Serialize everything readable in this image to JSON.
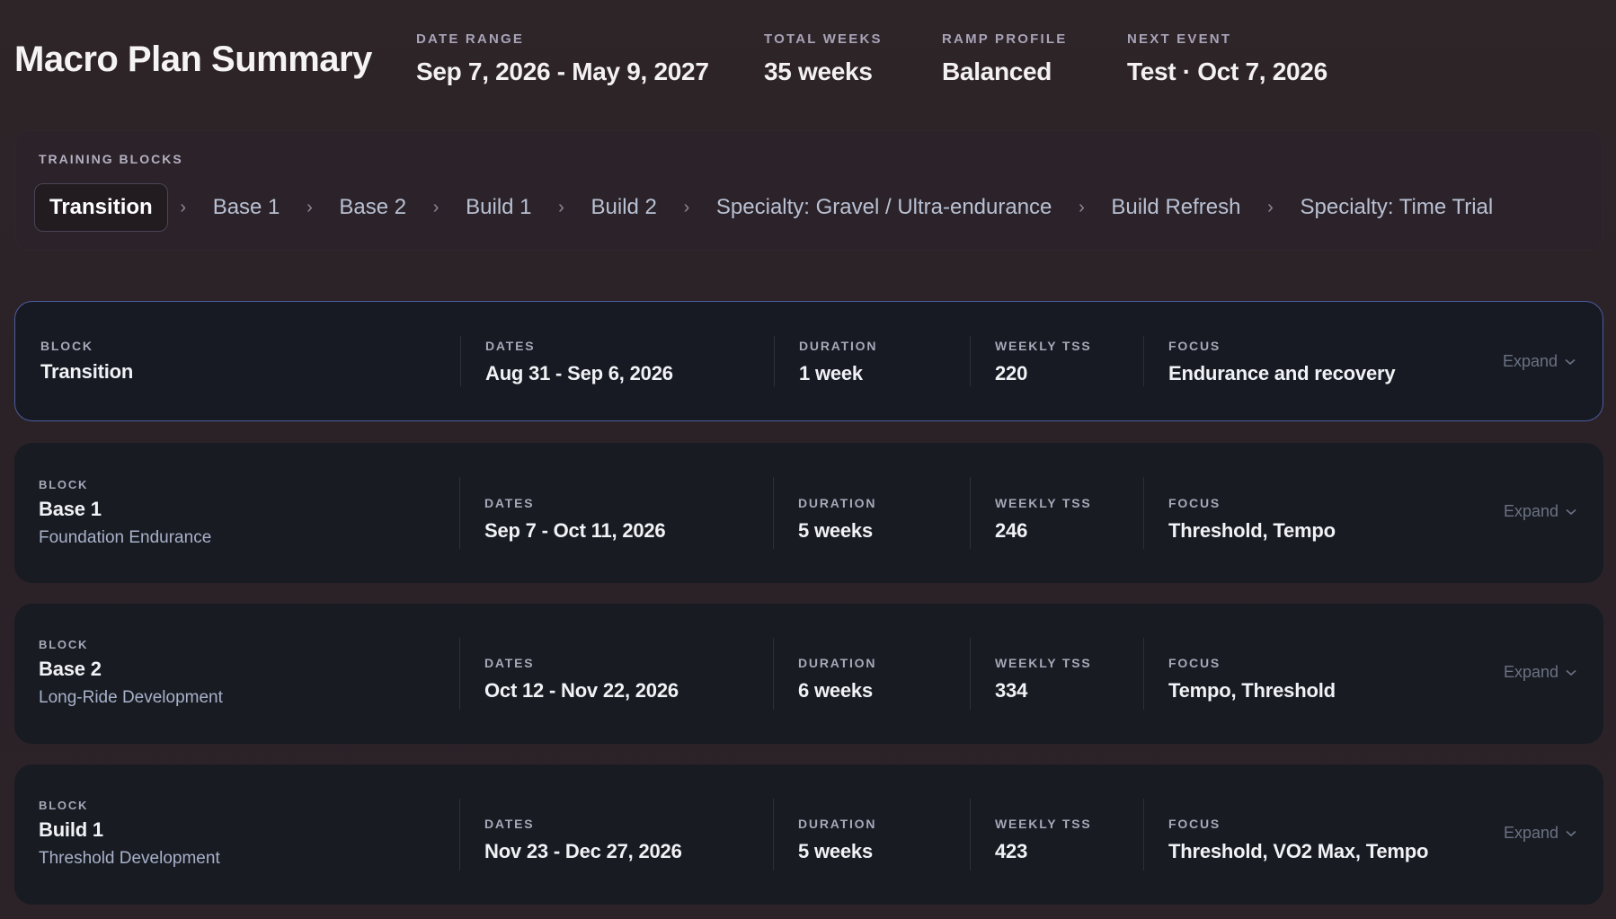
{
  "header": {
    "title": "Macro Plan Summary",
    "stats": [
      {
        "label": "DATE RANGE",
        "value": "Sep 7, 2026 - May 9, 2027"
      },
      {
        "label": "TOTAL WEEKS",
        "value": "35 weeks"
      },
      {
        "label": "RAMP PROFILE",
        "value": "Balanced"
      },
      {
        "label": "NEXT EVENT",
        "value": "Test · Oct 7, 2026"
      }
    ]
  },
  "training_blocks": {
    "title": "TRAINING BLOCKS",
    "items": [
      {
        "label": "Transition",
        "active": true
      },
      {
        "label": "Base 1",
        "active": false
      },
      {
        "label": "Base 2",
        "active": false
      },
      {
        "label": "Build 1",
        "active": false
      },
      {
        "label": "Build 2",
        "active": false
      },
      {
        "label": "Specialty: Gravel / Ultra-endurance",
        "active": false
      },
      {
        "label": "Build Refresh",
        "active": false
      },
      {
        "label": "Specialty: Time Trial",
        "active": false
      }
    ],
    "separator_icon": "chevron-right-icon"
  },
  "column_labels": {
    "block": "BLOCK",
    "dates": "DATES",
    "duration": "DURATION",
    "weekly_tss": "WEEKLY TSS",
    "focus": "FOCUS"
  },
  "expand_label": "Expand",
  "blocks": [
    {
      "name": "Transition",
      "subtitle": "",
      "dates": "Aug 31 - Sep 6, 2026",
      "duration": "1 week",
      "weekly_tss": "220",
      "focus": "Endurance and recovery",
      "selected": true
    },
    {
      "name": "Base 1",
      "subtitle": "Foundation Endurance",
      "dates": "Sep 7 - Oct 11, 2026",
      "duration": "5 weeks",
      "weekly_tss": "246",
      "focus": "Threshold, Tempo",
      "selected": false
    },
    {
      "name": "Base 2",
      "subtitle": "Long-Ride Development",
      "dates": "Oct 12 - Nov 22, 2026",
      "duration": "6 weeks",
      "weekly_tss": "334",
      "focus": "Tempo, Threshold",
      "selected": false
    },
    {
      "name": "Build 1",
      "subtitle": "Threshold Development",
      "dates": "Nov 23 - Dec 27, 2026",
      "duration": "5 weeks",
      "weekly_tss": "423",
      "focus": "Threshold, VO2 Max, Tempo",
      "selected": false
    }
  ],
  "colors": {
    "background": "#2b2328",
    "card": "#181b22",
    "selected_border": "#4b5da0",
    "muted_text": "#a8b1c9"
  }
}
